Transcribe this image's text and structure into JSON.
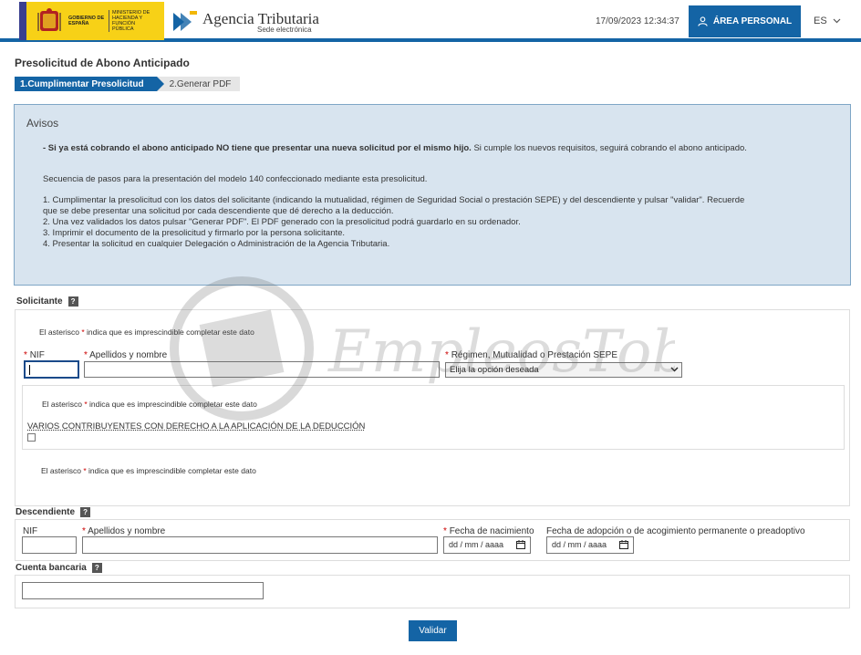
{
  "header": {
    "gov_text_1": "GOBIERNO DE ESPAÑA",
    "gov_text_2": "MINISTERIO DE HACIENDA Y FUNCIÓN PÚBLICA",
    "agency_title": "Agencia Tributaria",
    "agency_sub": "Sede electrónica",
    "datetime": "17/09/2023 12:34:37",
    "area_button": "ÁREA PERSONAL",
    "lang": "ES"
  },
  "page": {
    "title": "Presolicitud de Abono Anticipado",
    "steps": [
      "1.Cumplimentar Presolicitud",
      "2.Generar PDF"
    ]
  },
  "avisos": {
    "title": "Avisos",
    "bold_line": "- Si ya está cobrando el abono anticipado NO tiene que presentar una nueva solicitud por el mismo hijo.",
    "bold_line_rest": " Si cumple los nuevos requisitos, seguirá cobrando el abono anticipado.",
    "sequence": "Secuencia de pasos para la presentación del modelo 140 confeccionado mediante esta presolicitud.",
    "step1a": "1. Cumplimentar la presolicitud con los datos del solicitante (indicando la mutualidad, régimen de Seguridad Social o prestación SEPE) y del descendiente y pulsar \"validar\". Recuerde",
    "step1b": "que se debe presentar una solicitud por cada descendiente que dé derecho a la deducción.",
    "step2": "2. Una vez validados los datos pulsar \"Generar PDF\". El PDF generado con la presolicitud podrá guardarlo en su ordenador.",
    "step3": "3. Imprimir el documento de la presolicitud y firmarlo por la persona solicitante.",
    "step4": "4. Presentar la solicitud en cualquier Delegación o Administración de la Agencia Tributaria."
  },
  "solicitante": {
    "label": "Solicitante",
    "note_prefix": "El asterisco",
    "note_suffix": "indica que es imprescindible completar este dato",
    "asterisk": "*",
    "nif_label": "NIF",
    "apellidos_label": "Apellidos y nombre",
    "regimen_label": "Régimen, Mutualidad o Prestación SEPE",
    "regimen_value": "Elija la opción deseada",
    "varios_label": "VARIOS CONTRIBUYENTES CON DERECHO A LA APLICACIÓN DE LA DEDUCCIÓN"
  },
  "descendiente": {
    "label": "Descendiente",
    "nif_label": "NIF",
    "apellidos_label": "Apellidos y nombre",
    "fecha_nac_label": "Fecha de nacimiento",
    "fecha_adop_label": "Fecha de adopción o de acogimiento permanente o preadoptivo",
    "date_placeholder": "dd / mm / aaaa"
  },
  "cuenta": {
    "label": "Cuenta bancaria"
  },
  "actions": {
    "validar": "Validar"
  },
  "watermark": "EmpleosTob.es",
  "colors": {
    "brand_blue": "#1464a5",
    "avisos_bg": "#d8e4ef",
    "required": "#cc0000"
  }
}
